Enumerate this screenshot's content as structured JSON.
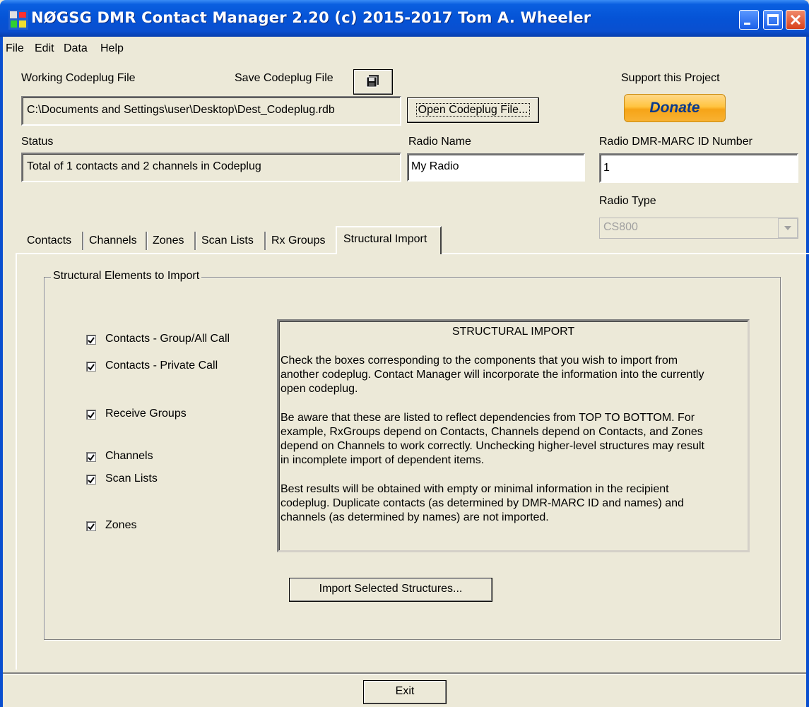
{
  "window": {
    "title": "NØGSG DMR Contact Manager 2.20 (c) 2015-2017 Tom A. Wheeler"
  },
  "menu": {
    "items": [
      "File",
      "Edit",
      "Data",
      "Help"
    ]
  },
  "codeplug": {
    "working_label": "Working Codeplug File",
    "save_label": "Save Codeplug File",
    "file_path": "C:\\Documents and Settings\\user\\Desktop\\Dest_Codeplug.rdb",
    "open_button": "Open Codeplug File..."
  },
  "support": {
    "label": "Support this Project",
    "donate_button": "Donate"
  },
  "status": {
    "label": "Status",
    "text": "Total of 1 contacts and 2 channels in Codeplug"
  },
  "radio": {
    "name_label": "Radio Name",
    "name_value": "My Radio",
    "id_label": "Radio DMR-MARC ID Number",
    "id_value": "1",
    "type_label": "Radio Type",
    "type_value": "CS800"
  },
  "tabs": [
    "Contacts",
    "Channels",
    "Zones",
    "Scan Lists",
    "Rx Groups",
    "Structural Import"
  ],
  "active_tab": "Structural Import",
  "structural": {
    "group_title": "Structural Elements to Import",
    "checkboxes": [
      {
        "label": "Contacts - Group/All Call",
        "checked": true
      },
      {
        "label": "Contacts - Private Call",
        "checked": true
      },
      {
        "label": "Receive Groups",
        "checked": true
      },
      {
        "label": "Channels",
        "checked": true
      },
      {
        "label": "Scan Lists",
        "checked": true
      },
      {
        "label": "Zones",
        "checked": true
      }
    ],
    "info_title": "STRUCTURAL IMPORT",
    "info_paragraphs": [
      [
        "Check the boxes corresponding to the components that you wish to import from",
        "another codeplug. Contact Manager will incorporate the information into the currently",
        "open codeplug."
      ],
      [
        "Be aware that these are listed to reflect dependencies from TOP TO BOTTOM. For",
        "example, RxGroups depend on Contacts, Channels depend on Contacts, and Zones",
        "depend on Channels to work correctly. Unchecking higher-level structures may result",
        "in incomplete import of dependent items."
      ],
      [
        "Best results will be obtained with empty or minimal information in the recipient",
        "codeplug. Duplicate contacts (as determined by DMR-MARC ID and names) and",
        "channels (as determined by names) are not imported."
      ]
    ],
    "import_button": "Import Selected Structures..."
  },
  "exit_button": "Exit",
  "colors": {
    "titlebar": "#0553d6",
    "face": "#ece9d8",
    "donate_text": "#0b3a8c",
    "donate_fill": "#ffc440"
  }
}
